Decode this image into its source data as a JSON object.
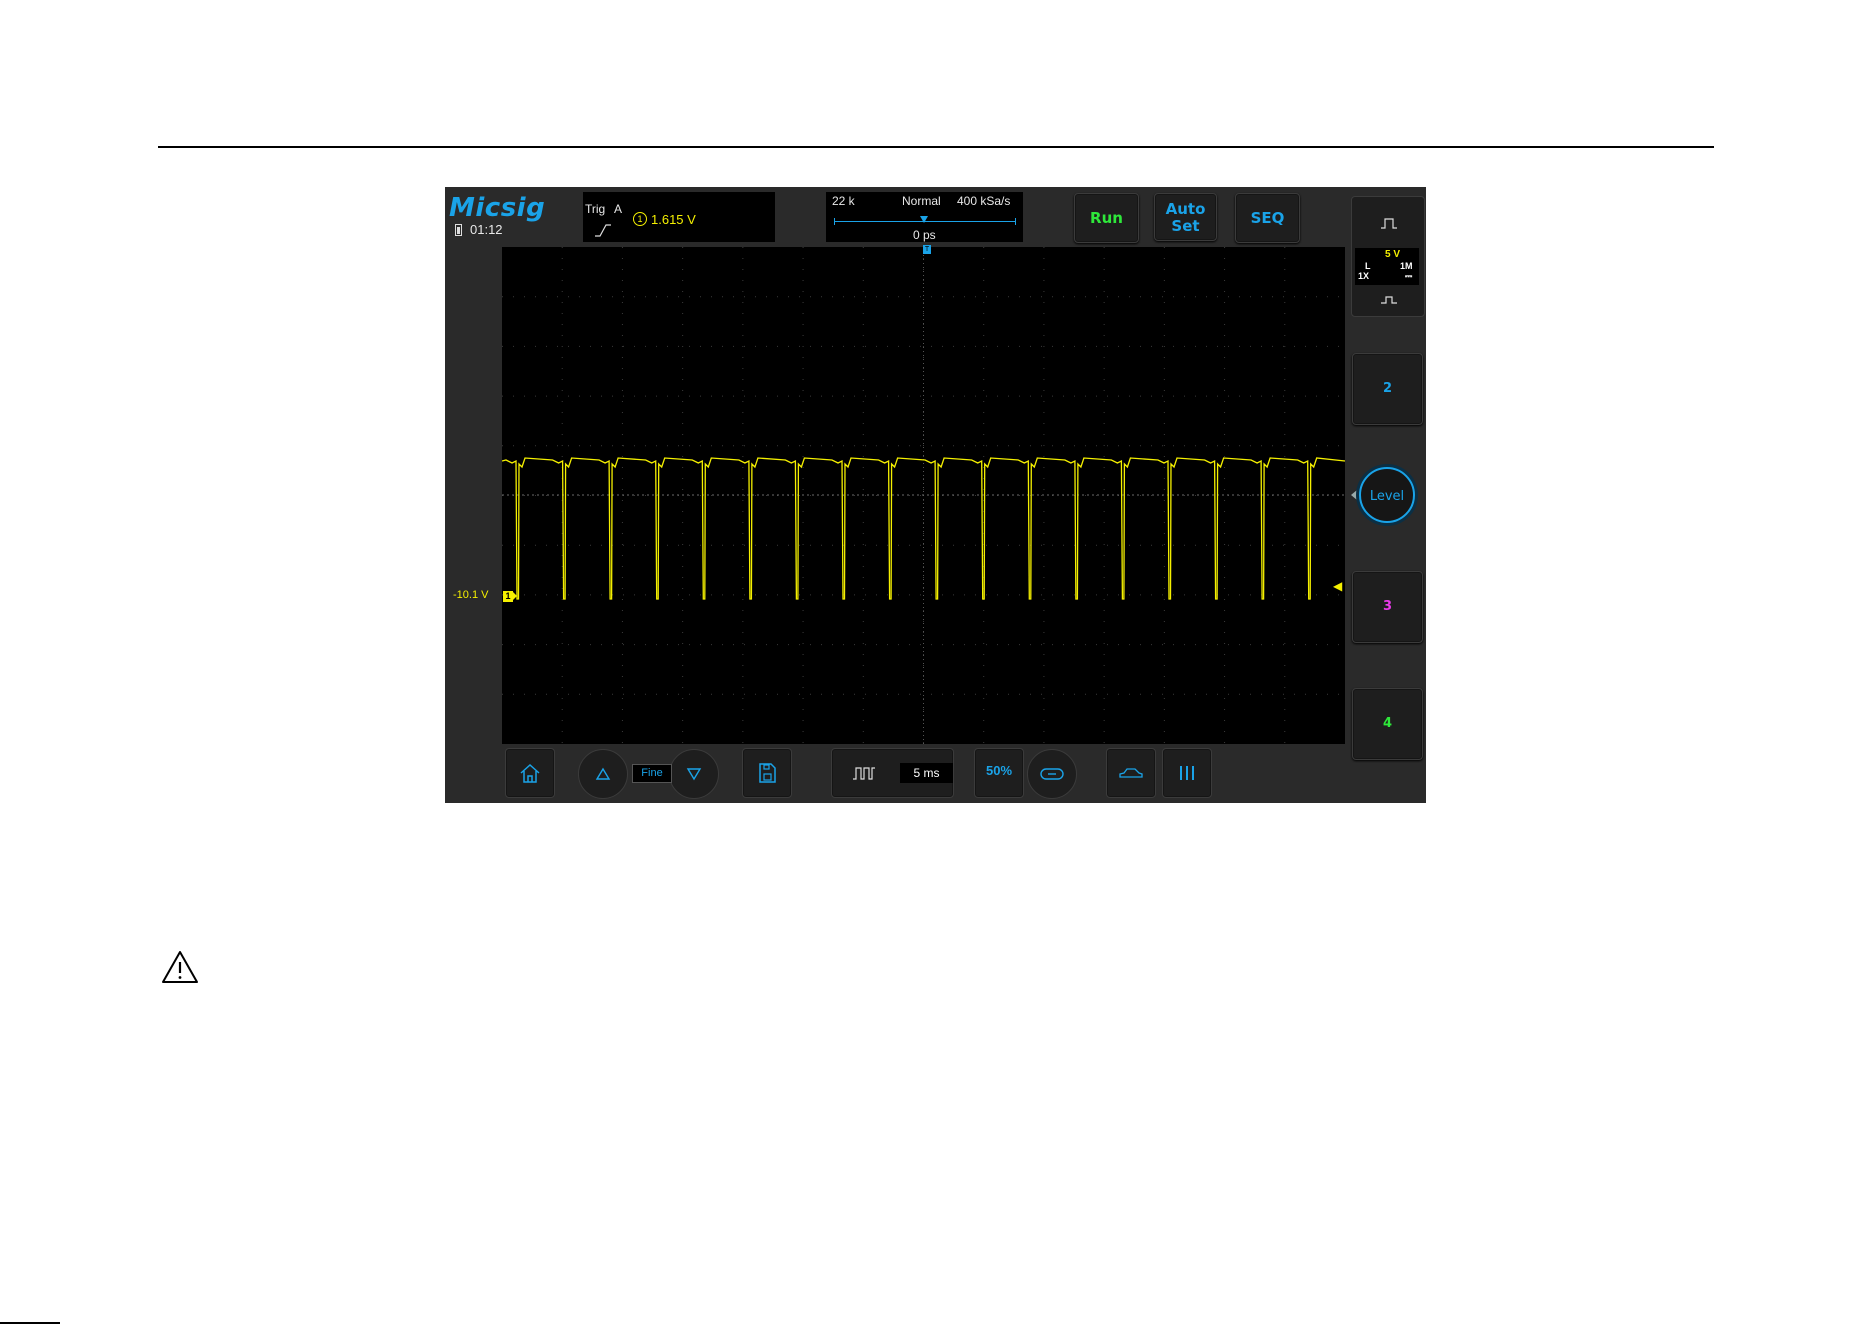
{
  "device": {
    "brand": "Micsig",
    "clock": "01:12",
    "colors": {
      "accent": "#1aa3e8",
      "ch1": "#f5f000",
      "ch2": "#1aa3e8",
      "ch3": "#e83ae8",
      "ch4": "#2ee83a",
      "run": "#2ee83a"
    }
  },
  "trigger": {
    "label": "Trig",
    "source": "A",
    "channel": "1",
    "level": "1.615 V",
    "slope_icon": "rising-edge-icon"
  },
  "timebase_panel": {
    "memory_depth": "22 k",
    "mode": "Normal",
    "sample_rate": "400 kSa/s",
    "delay": "0 ps"
  },
  "buttons": {
    "run": "Run",
    "auto_set_line1": "Auto",
    "auto_set_line2": "Set",
    "seq": "SEQ",
    "level": "Level",
    "fine": "Fine"
  },
  "channels": {
    "ch1": {
      "volts_per_div": "5 V",
      "coupling_label": "L",
      "impedance": "1M",
      "probe": "1X",
      "dc_symbol": "⎓",
      "offset_label": "-10.1 V",
      "marker": "1"
    },
    "ch2": {
      "label": "2"
    },
    "ch3": {
      "label": "3"
    },
    "ch4": {
      "label": "4"
    }
  },
  "toolbar": {
    "timebase": "5 ms",
    "fifty_percent": "50%"
  },
  "waveform": {
    "high_level_v": 0,
    "low_level_v": -1.2,
    "pulse_count": 18,
    "period_ms": 5
  }
}
